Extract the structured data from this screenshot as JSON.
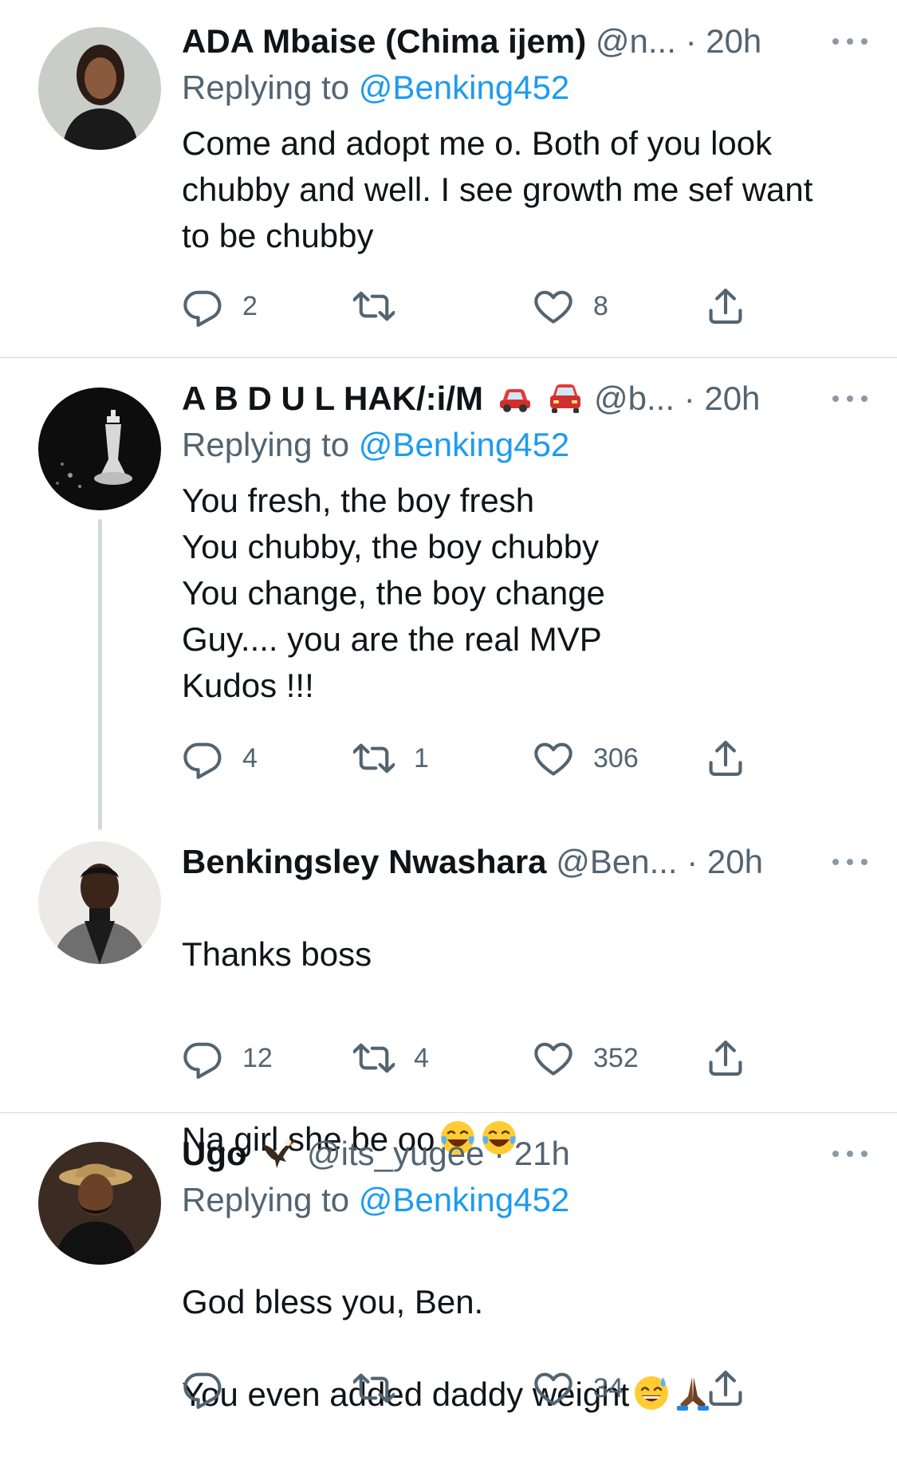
{
  "tweets": [
    {
      "name": "ADA Mbaise (Chima ijem)",
      "handle": "@n...",
      "time": "· 20h",
      "replying_label": "Replying to",
      "replying_to": "@Benking452",
      "text": "Come and adopt me o. Both of you look chubby and   well. I see growth me sef want to be chubby",
      "replies": "2",
      "retweets": "",
      "likes": "8"
    },
    {
      "name": "A B D U L HAK/:i/M",
      "handle": "@b...",
      "time": "· 20h",
      "replying_label": "Replying to",
      "replying_to": "@Benking452",
      "text": "You fresh, the boy fresh\nYou chubby, the boy chubby\nYou change, the boy change\nGuy.... you are the real MVP\nKudos !!!",
      "replies": "4",
      "retweets": "1",
      "likes": "306"
    },
    {
      "name": "Benkingsley Nwashara",
      "handle": "@Ben...",
      "time": "· 20h",
      "text_line1": "Thanks boss",
      "text_line2": "Na girl she be oo",
      "replies": "12",
      "retweets": "4",
      "likes": "352"
    },
    {
      "name": "Ugo",
      "handle": "@its_yugee",
      "time": "· 21h",
      "replying_label": "Replying to",
      "replying_to": "@Benking452",
      "text_line1": "God bless you, Ben.",
      "text_line2": "You even added daddy weight",
      "replies": "",
      "retweets": "",
      "likes": "34"
    }
  ],
  "icons": {
    "reply": "reply-icon",
    "retweet": "retweet-icon",
    "like": "heart-icon",
    "share": "share-icon",
    "more": "more-icon"
  },
  "colors": {
    "link": "#1d9bf0",
    "secondary": "#536471",
    "divider": "#cfd9de"
  }
}
